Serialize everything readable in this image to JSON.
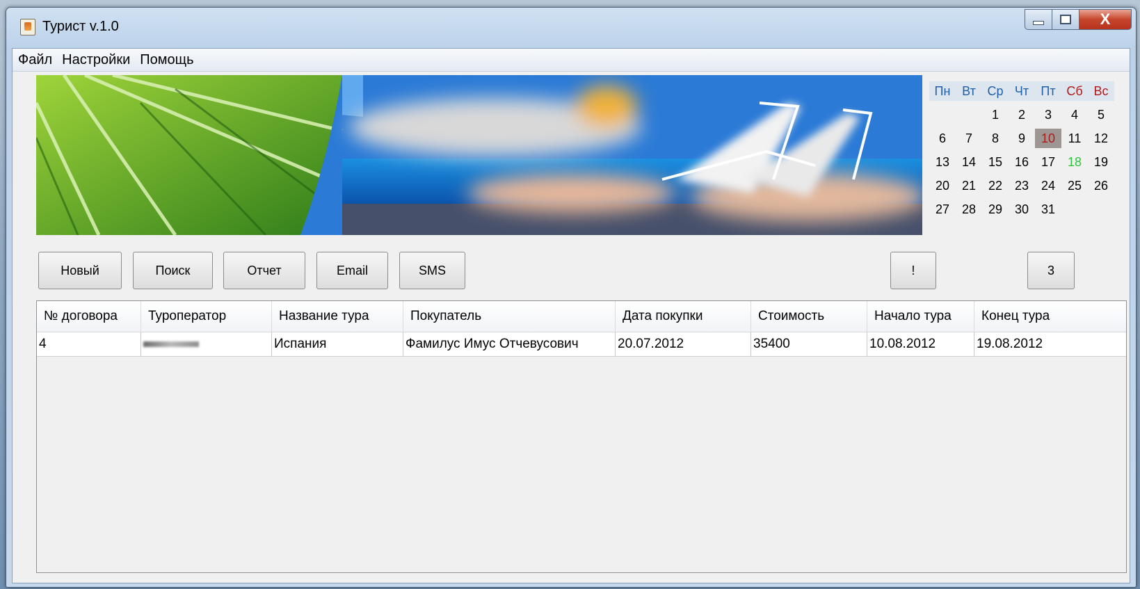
{
  "window": {
    "title": "Турист v.1.0",
    "close_glyph": "X"
  },
  "menu": [
    {
      "label": "Файл"
    },
    {
      "label": "Настройки"
    },
    {
      "label": "Помощь"
    }
  ],
  "calendar": {
    "headers": [
      "Пн",
      "Вт",
      "Ср",
      "Чт",
      "Пт",
      "Сб",
      "Вс"
    ],
    "weeks": [
      [
        "",
        "",
        "1",
        "2",
        "3",
        "4",
        "5"
      ],
      [
        "6",
        "7",
        "8",
        "9",
        "10",
        "11",
        "12"
      ],
      [
        "13",
        "14",
        "15",
        "16",
        "17",
        "18",
        "19"
      ],
      [
        "20",
        "21",
        "22",
        "23",
        "24",
        "25",
        "26"
      ],
      [
        "27",
        "28",
        "29",
        "30",
        "31",
        "",
        ""
      ]
    ],
    "today": "10",
    "holiday": "18",
    "colors": {
      "weekend_header": "#b01919",
      "today_bg": "#9d9692",
      "holiday": "#2bc43a"
    }
  },
  "toolbar": {
    "new_label": "Новый",
    "search_label": "Поиск",
    "report_label": "Отчет",
    "email_label": "Email",
    "sms_label": "SMS",
    "alert_label": "!",
    "count_label": "3"
  },
  "table": {
    "columns": [
      "№ договора",
      "Туроператор",
      "Название тура",
      "Покупатель",
      "Дата покупки",
      "Стоимость",
      "Начало тура",
      "Конец тура"
    ],
    "rows": [
      {
        "contract": "4",
        "operator": "",
        "tour": "Испания",
        "buyer": "Фамилус Имус Отчевусович",
        "purchase_date": "20.07.2012",
        "price": "35400",
        "start": "10.08.2012",
        "end": "19.08.2012"
      }
    ]
  }
}
